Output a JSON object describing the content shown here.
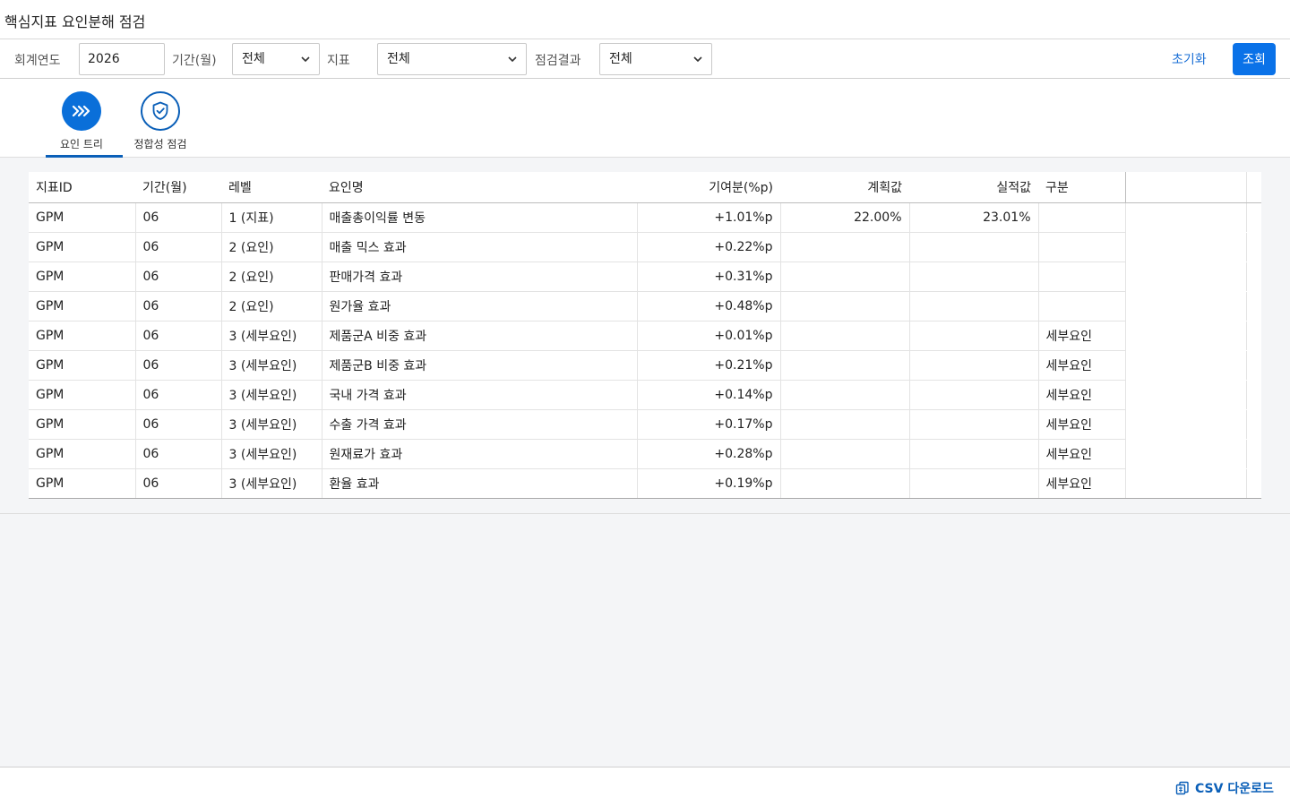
{
  "page": {
    "title": "핵심지표 요인분해 점검"
  },
  "filters": {
    "year_label": "회계연도",
    "year_value": "2026",
    "period_label": "기간(월)",
    "period_value": "전체",
    "metric_label": "지표",
    "metric_value": "전체",
    "result_label": "점검결과",
    "result_value": "전체",
    "reset_label": "초기화",
    "search_label": "조회"
  },
  "tabs": [
    {
      "label": "요인 트리",
      "icon": "chevrons-right-icon",
      "active": true
    },
    {
      "label": "정합성 점검",
      "icon": "shield-check-icon",
      "active": false
    }
  ],
  "table": {
    "headers": [
      "지표ID",
      "기간(월)",
      "레벨",
      "요인명",
      "기여분(%p)",
      "계획값",
      "실적값",
      "구분"
    ],
    "rows": [
      {
        "id": "GPM",
        "period": "06",
        "level": "1 (지표)",
        "name": "매출총이익률 변동",
        "contrib": "+1.01%p",
        "plan": "22.00%",
        "actual": "23.01%",
        "type": ""
      },
      {
        "id": "GPM",
        "period": "06",
        "level": "2 (요인)",
        "name": "매출 믹스 효과",
        "contrib": "+0.22%p",
        "plan": "",
        "actual": "",
        "type": ""
      },
      {
        "id": "GPM",
        "period": "06",
        "level": "2 (요인)",
        "name": "판매가격 효과",
        "contrib": "+0.31%p",
        "plan": "",
        "actual": "",
        "type": ""
      },
      {
        "id": "GPM",
        "period": "06",
        "level": "2 (요인)",
        "name": "원가율 효과",
        "contrib": "+0.48%p",
        "plan": "",
        "actual": "",
        "type": ""
      },
      {
        "id": "GPM",
        "period": "06",
        "level": "3 (세부요인)",
        "name": "제품군A 비중 효과",
        "contrib": "+0.01%p",
        "plan": "",
        "actual": "",
        "type": "세부요인"
      },
      {
        "id": "GPM",
        "period": "06",
        "level": "3 (세부요인)",
        "name": "제품군B 비중 효과",
        "contrib": "+0.21%p",
        "plan": "",
        "actual": "",
        "type": "세부요인"
      },
      {
        "id": "GPM",
        "period": "06",
        "level": "3 (세부요인)",
        "name": "국내 가격 효과",
        "contrib": "+0.14%p",
        "plan": "",
        "actual": "",
        "type": "세부요인"
      },
      {
        "id": "GPM",
        "period": "06",
        "level": "3 (세부요인)",
        "name": "수출 가격 효과",
        "contrib": "+0.17%p",
        "plan": "",
        "actual": "",
        "type": "세부요인"
      },
      {
        "id": "GPM",
        "period": "06",
        "level": "3 (세부요인)",
        "name": "원재료가 효과",
        "contrib": "+0.28%p",
        "plan": "",
        "actual": "",
        "type": "세부요인"
      },
      {
        "id": "GPM",
        "period": "06",
        "level": "3 (세부요인)",
        "name": "환율 효과",
        "contrib": "+0.19%p",
        "plan": "",
        "actual": "",
        "type": "세부요인"
      }
    ]
  },
  "footer": {
    "csv_label": "CSV 다운로드",
    "csv_icon": "csv-export-icon"
  },
  "colors": {
    "accent": "#0a72e8",
    "link": "#1a6fd6"
  }
}
